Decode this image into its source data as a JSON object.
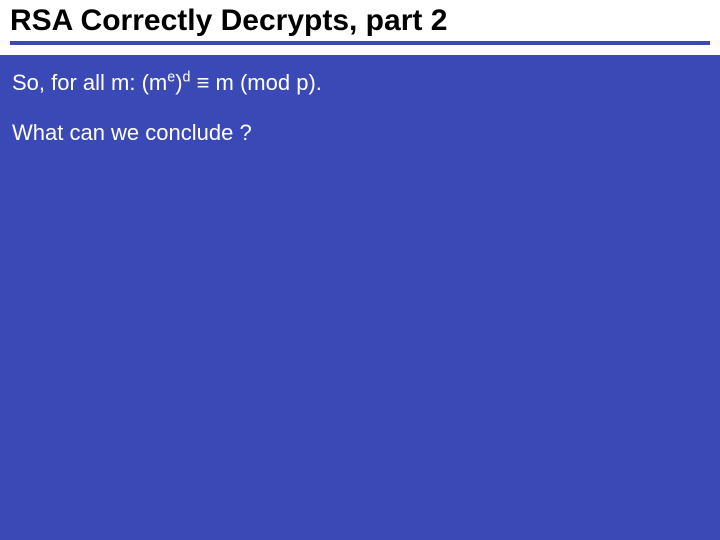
{
  "title": "RSA Correctly Decrypts, part 2",
  "line1_prefix": "So, for all m:  (m",
  "line1_sup1": "e",
  "line1_mid": ")",
  "line1_sup2": "d",
  "line1_suffix": " ≡ m (mod p).",
  "line2": "What can we conclude ?"
}
